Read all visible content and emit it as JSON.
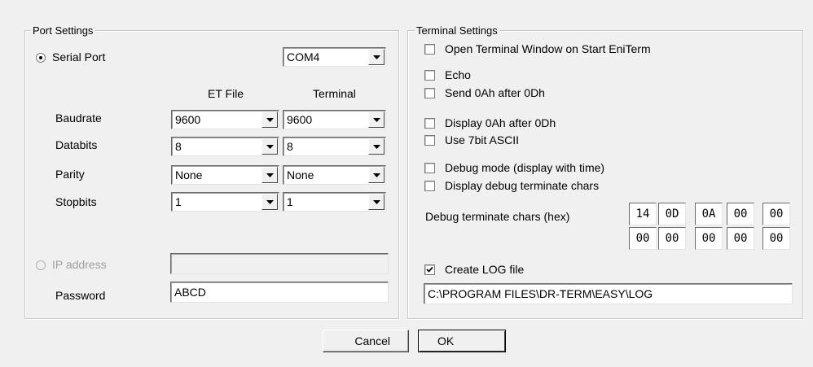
{
  "port": {
    "legend": "Port Settings",
    "serial_label": "Serial Port",
    "serial_selected": true,
    "com_port": "COM4",
    "col_et": "ET File",
    "col_term": "Terminal",
    "rows": [
      {
        "label": "Baudrate",
        "et": "9600",
        "term": "9600"
      },
      {
        "label": "Databits",
        "et": "8",
        "term": "8"
      },
      {
        "label": "Parity",
        "et": "None",
        "term": "None"
      },
      {
        "label": "Stopbits",
        "et": "1",
        "term": "1"
      }
    ],
    "ip_label": "IP address",
    "ip_value": "",
    "password_label": "Password",
    "password_value": "ABCD"
  },
  "terminal": {
    "legend": "Terminal Settings",
    "options": [
      {
        "label": "Open Terminal Window on Start EniTerm",
        "checked": false
      },
      {
        "label": "Echo",
        "checked": false
      },
      {
        "label": "Send 0Ah after 0Dh",
        "checked": false
      },
      {
        "label": "Display 0Ah after 0Dh",
        "checked": false
      },
      {
        "label": "Use 7bit ASCII",
        "checked": false
      },
      {
        "label": "Debug mode (display with time)",
        "checked": false
      },
      {
        "label": "Display debug terminate chars",
        "checked": false
      }
    ],
    "debug_chars_label": "Debug terminate chars (hex)",
    "debug_chars": [
      [
        "14",
        "0D",
        "0A",
        "00",
        "00"
      ],
      [
        "00",
        "00",
        "00",
        "00",
        "00"
      ]
    ],
    "log_label": "Create LOG file",
    "log_checked": true,
    "log_path": "C:\\PROGRAM FILES\\DR-TERM\\EASY\\LOG"
  },
  "buttons": {
    "cancel": "Cancel",
    "ok": "OK"
  }
}
